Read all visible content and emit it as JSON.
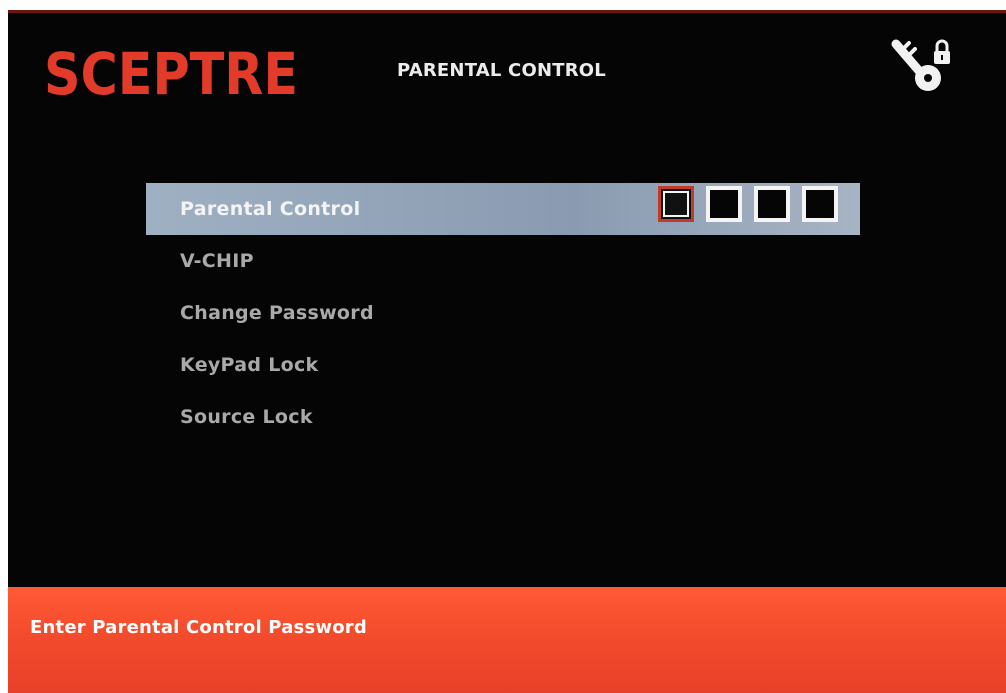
{
  "header": {
    "brand": "SCEPTRE",
    "title": "PARENTAL CONTROL",
    "icon": "key-lock-icon"
  },
  "menu": {
    "items": [
      {
        "label": "Parental Control",
        "selected": true
      },
      {
        "label": "V-CHIP"
      },
      {
        "label": "Change Password"
      },
      {
        "label": "KeyPad Lock"
      },
      {
        "label": "Source Lock"
      }
    ],
    "pin_digits": 4,
    "active_pin_index": 0
  },
  "footer": {
    "hint": "Enter Parental Control Password"
  },
  "colors": {
    "brand_red": "#e23b2a",
    "footer_bar": "#f14a2c",
    "selected_row": "#9fb0c3"
  }
}
